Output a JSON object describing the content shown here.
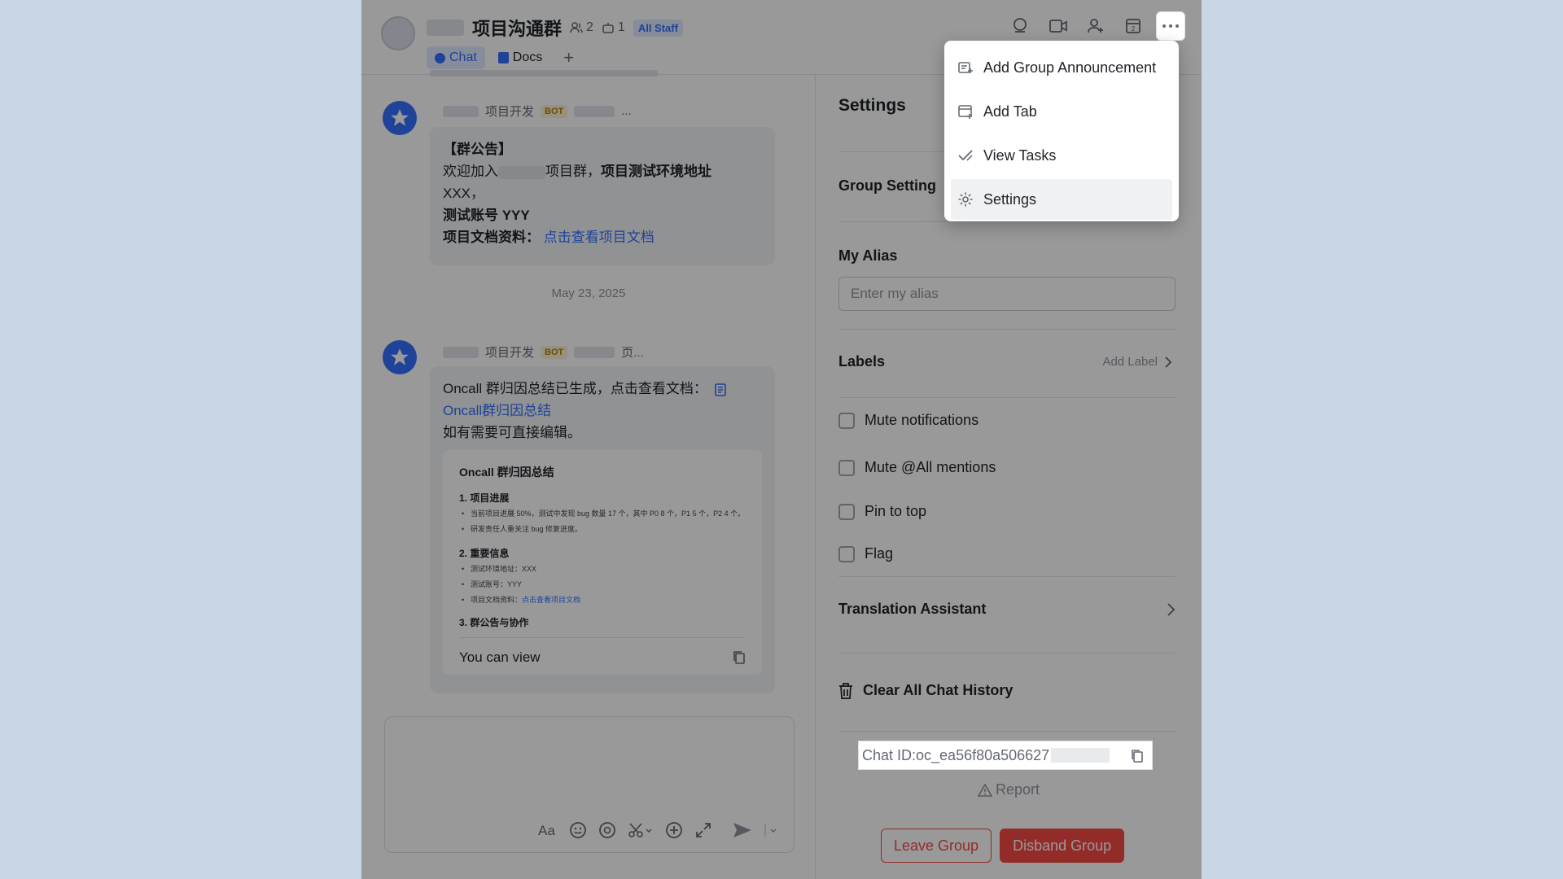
{
  "header": {
    "group_title": "项目沟通群",
    "member_count": "2",
    "bot_count": "1",
    "badge": "All Staff",
    "tabs": [
      {
        "label": "Chat"
      },
      {
        "label": "Docs"
      }
    ],
    "add_tab_symbol": "+"
  },
  "chat": {
    "messages": [
      {
        "sender": "项目开发",
        "badge": "BOT",
        "sender_suffix": "...",
        "title": "【群公告】",
        "line1_a": "欢迎加入",
        "line1_b": "项目群，",
        "line1_c": "项目测试环境地址",
        "line2": "XXX，",
        "line3": "测试账号 YYY",
        "line4_label": "项目文档资料：",
        "line4_link": "点击查看项目文档"
      },
      {
        "sender": "项目开发",
        "badge": "BOT",
        "sender_suffix": "页...",
        "text1": "Oncall 群归因总结已生成，点击查看文档：",
        "link": "Oncall群归因总结",
        "text2": "如有需要可直接编辑。",
        "card": {
          "title": "Oncall 群归因总结",
          "s1": "1. 项目进展",
          "s1_items": [
            "当前项目进展 50%，测试中发现 bug 数量 17 个，其中 P0 8 个，P1 5 个，P2 4 个。",
            "研发责任人重关注 bug 修复进度。"
          ],
          "s2": "2. 重要信息",
          "s2_items": [
            "测试环境地址：XXX",
            "测试账号：YYY"
          ],
          "s2_item3_label": "项目文档资料：",
          "s2_item3_link": "点击查看项目文档",
          "s3": "3. 群公告与协作",
          "footer": "You can view"
        }
      }
    ],
    "date_separator": "May 23, 2025"
  },
  "settings": {
    "title": "Settings",
    "group_setting": "Group Setting",
    "my_alias_label": "My Alias",
    "alias_placeholder": "Enter my alias",
    "labels": "Labels",
    "add_label": "Add Label",
    "checks": [
      "Mute notifications",
      "Mute @All mentions",
      "Pin to top",
      "Flag"
    ],
    "translation": "Translation Assistant",
    "clear_history": "Clear All Chat History",
    "chat_id": "Chat ID:oc_ea56f80a506627",
    "report": "Report",
    "leave": "Leave Group",
    "disband": "Disband Group"
  },
  "menu": {
    "items": [
      "Add Group Announcement",
      "Add Tab",
      "View Tasks",
      "Settings"
    ],
    "active": "Settings"
  },
  "colors": {
    "accent": "#3370ff",
    "danger": "#f54a45",
    "backdrop": "#c9d6e6"
  }
}
